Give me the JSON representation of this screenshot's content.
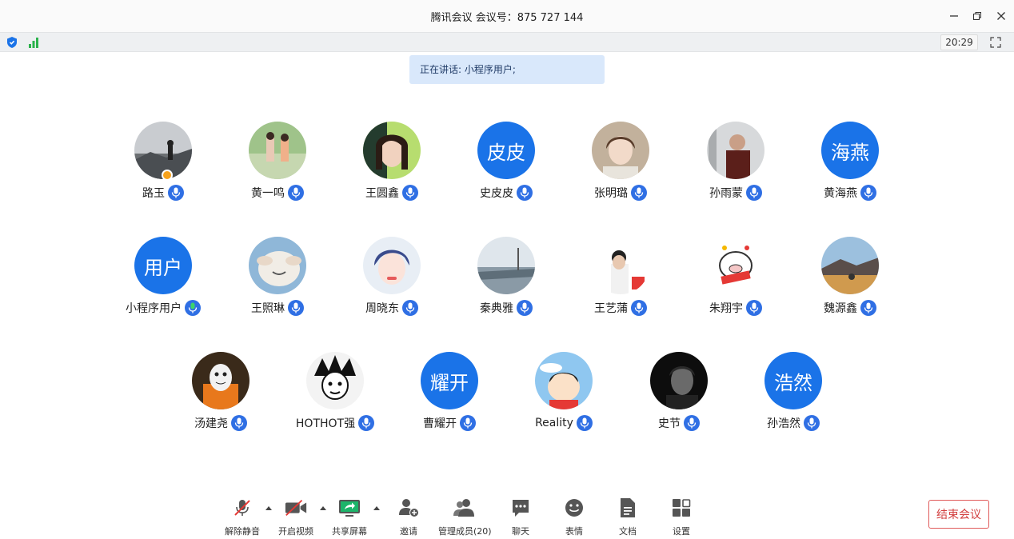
{
  "window": {
    "title": "腾讯会议  会议号：875 727 144"
  },
  "status": {
    "clock": "20:29"
  },
  "speaking": {
    "text": "正在讲话: 小程序用户;"
  },
  "participants": [
    {
      "name": "路玉",
      "avatar_text": ""
    },
    {
      "name": "黄一鸣",
      "avatar_text": ""
    },
    {
      "name": "王圆鑫",
      "avatar_text": ""
    },
    {
      "name": "史皮皮",
      "avatar_text": "皮皮"
    },
    {
      "name": "张明璐",
      "avatar_text": ""
    },
    {
      "name": "孙雨蒙",
      "avatar_text": ""
    },
    {
      "name": "黄海燕",
      "avatar_text": "海燕"
    },
    {
      "name": "小程序用户",
      "avatar_text": "用户"
    },
    {
      "name": "王照琳",
      "avatar_text": ""
    },
    {
      "name": "周晓东",
      "avatar_text": ""
    },
    {
      "name": "秦典雅",
      "avatar_text": ""
    },
    {
      "name": "王艺蒲",
      "avatar_text": ""
    },
    {
      "name": "朱翔宇",
      "avatar_text": ""
    },
    {
      "name": "魏源鑫",
      "avatar_text": ""
    },
    {
      "name": "汤建尧",
      "avatar_text": ""
    },
    {
      "name": "HOTHOT强",
      "avatar_text": ""
    },
    {
      "name": "曹耀开",
      "avatar_text": "耀开"
    },
    {
      "name": "Reality",
      "avatar_text": ""
    },
    {
      "name": "史节",
      "avatar_text": ""
    },
    {
      "name": "孙浩然",
      "avatar_text": "浩然"
    }
  ],
  "toolbar": {
    "unmute": "解除静音",
    "start_video": "开启视频",
    "share_screen": "共享屏幕",
    "invite": "邀请",
    "members": "管理成员(20)",
    "chat": "聊天",
    "reactions": "表情",
    "docs": "文档",
    "settings": "设置"
  },
  "end_meeting": "结束会议",
  "colors": {
    "accent": "#1a73e8",
    "danger": "#d23f3f",
    "speaking_bg": "#d9e8fb"
  }
}
